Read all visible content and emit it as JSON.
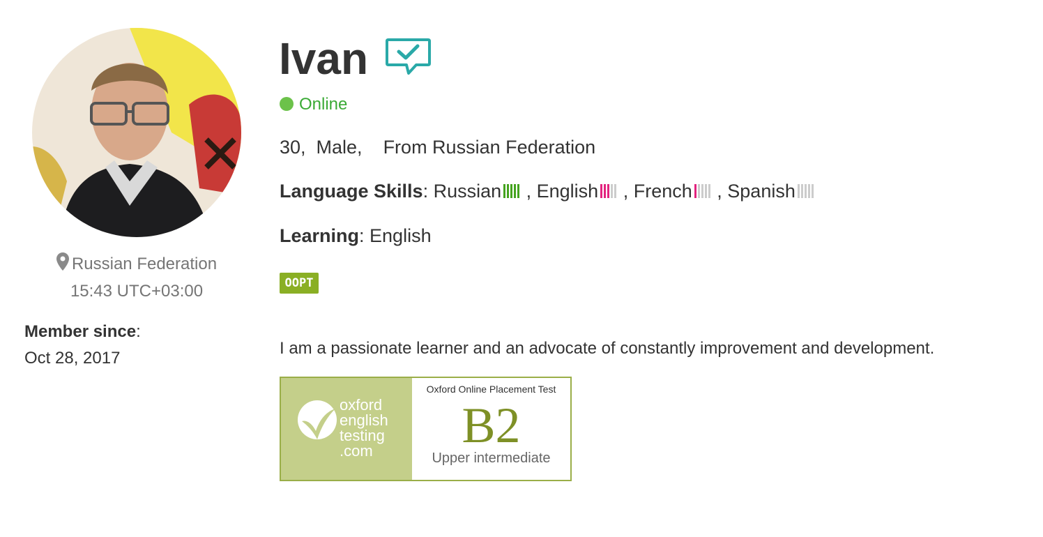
{
  "profile": {
    "name": "Ivan",
    "status": "Online",
    "basics": "30,  Male,    From Russian Federation",
    "location": "Russian Federation",
    "local_time": "15:43 UTC+03:00",
    "member_since_label": "Member since",
    "member_since_date": "Oct 28, 2017",
    "language_skills_label": "Language Skills",
    "languages": [
      {
        "name": "Russian",
        "level": 5,
        "color": "#45a31f",
        "sep": ""
      },
      {
        "name": "English",
        "level": 3,
        "color": "#e3237e",
        "sep": " , "
      },
      {
        "name": "French",
        "level": 1,
        "color": "#e3237e",
        "sep": " , "
      },
      {
        "name": "Spanish",
        "level": 0,
        "color": "#e3237e",
        "sep": " , "
      }
    ],
    "learning_label": "Learning",
    "learning": "English",
    "badge": "OOPT",
    "bio": "I am a passionate learner and an advocate of constantly improvement and development."
  },
  "oxford_certificate": {
    "brand_lines": [
      "oxford",
      "english",
      "testing",
      ".com"
    ],
    "test_name": "Oxford Online Placement Test",
    "level": "B2",
    "level_description": "Upper intermediate"
  },
  "icons": {
    "verified": "speech-bubble-check-icon",
    "location": "map-pin-icon"
  },
  "colors": {
    "online": "#3aaa35",
    "verified": "#2aa9a8",
    "native_bars": "#45a31f",
    "learning_bars": "#e3237e",
    "badge": "#8aaf24"
  }
}
